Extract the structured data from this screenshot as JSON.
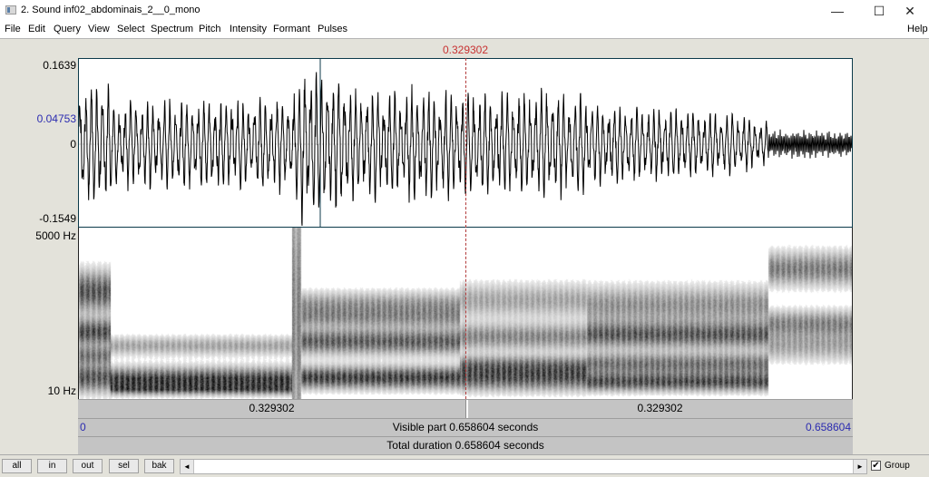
{
  "window": {
    "title": "2. Sound inf02_abdominais_2__0_mono",
    "controls": {
      "minimize": "—",
      "maximize": "☐",
      "close": "✕"
    }
  },
  "menu": {
    "items": [
      "File",
      "Edit",
      "Query",
      "View",
      "Select",
      "Spectrum",
      "Pitch",
      "Intensity",
      "Formant",
      "Pulses"
    ],
    "help": "Help"
  },
  "cursor": {
    "time_label": "0.329302",
    "color": "#c83232"
  },
  "waveform": {
    "y_max": "0.1639",
    "y_cursor_value": "0.04753",
    "y_zero": "0",
    "y_min": "-0.1549"
  },
  "spectrogram": {
    "y_top": "5000 Hz",
    "y_bottom": "10 Hz"
  },
  "time_bars": {
    "left_segment": "0.329302",
    "right_segment": "0.329302",
    "visible_start": "0",
    "visible_label": "Visible part 0.658604 seconds",
    "visible_end": "0.658604",
    "total_label": "Total duration 0.658604 seconds"
  },
  "bottom": {
    "buttons": [
      "all",
      "in",
      "out",
      "sel",
      "bak"
    ],
    "scroll_left": "◄",
    "scroll_right": "►",
    "group_checked": true,
    "group_check_mark": "✔",
    "group_label": "Group"
  }
}
